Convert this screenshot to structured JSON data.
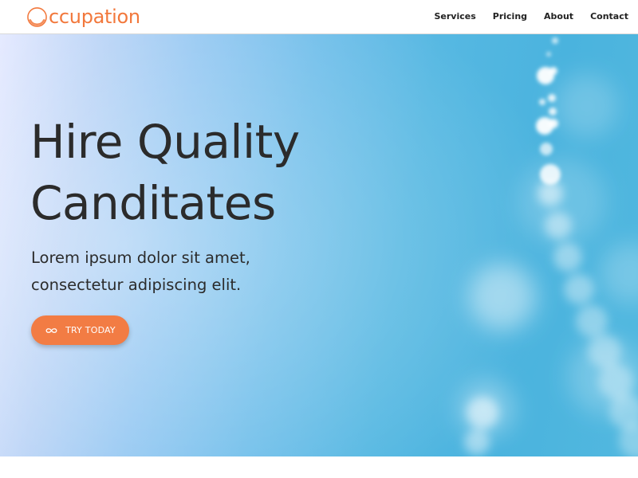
{
  "brand": {
    "name": "ccupation",
    "logo_icon": "ring-o-icon",
    "color": "#f2783c"
  },
  "nav": {
    "items": [
      {
        "label": "Services"
      },
      {
        "label": "Pricing"
      },
      {
        "label": "About"
      },
      {
        "label": "Contact"
      }
    ]
  },
  "hero": {
    "headline_line1": "Hire Quality",
    "headline_line2": "Canditates",
    "subtext_line1": "Lorem ipsum dolor sit amet,",
    "subtext_line2": "consectetur adipiscing elit.",
    "text_color": "#2b2b2b",
    "cta": {
      "label": "TRY TODAY",
      "icon": "infinity-icon",
      "color": "#f27c44"
    }
  }
}
